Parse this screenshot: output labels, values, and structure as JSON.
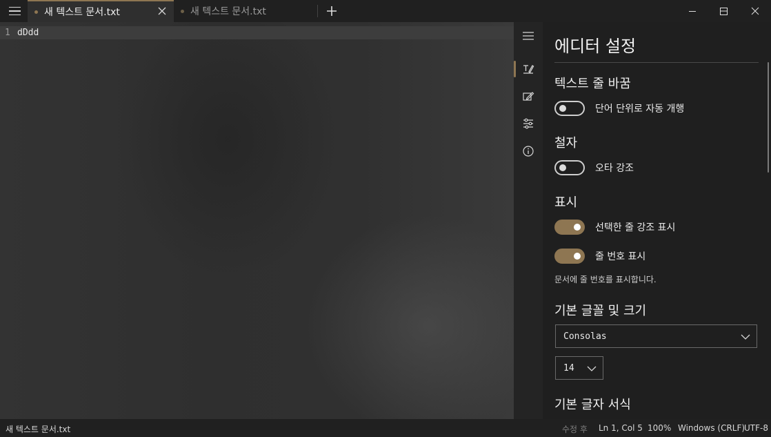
{
  "tabs": [
    {
      "title": "새 텍스트 문서.txt",
      "active": true
    },
    {
      "title": "새 텍스트 문서.txt",
      "active": false
    }
  ],
  "editor": {
    "line_number": "1",
    "content": "dDdd"
  },
  "rail": {
    "icons": [
      "menu-icon",
      "text-edit-icon",
      "note-edit-icon",
      "sliders-icon",
      "info-icon"
    ]
  },
  "settings": {
    "title": "에디터 설정",
    "sections": {
      "text_wrap": {
        "heading": "텍스트 줄 바꿈",
        "toggle_label": "단어 단위로 자동 개행",
        "on": false
      },
      "spelling": {
        "heading": "철자",
        "toggle_label": "오타 강조",
        "on": false
      },
      "display": {
        "heading": "표시",
        "highlight_label": "선택한 줄 강조 표시",
        "highlight_on": true,
        "line_numbers_label": "줄 번호 표시",
        "line_numbers_on": true,
        "description": "문서에 줄 번호를 표시합니다."
      },
      "font": {
        "heading": "기본 글꼴 및 크기",
        "font_family": "Consolas",
        "font_size": "14"
      },
      "format": {
        "heading": "기본 글자 서식"
      }
    }
  },
  "status": {
    "file_name": "새 텍스트 문서.txt",
    "modified": "수정 후",
    "position": "Ln 1, Col 5",
    "zoom": "100%",
    "line_ending": "Windows (CRLF)",
    "encoding": "UTF-8"
  },
  "colors": {
    "accent": "#8e7652",
    "background": "#2b2b2b",
    "panel": "#1f1f1f"
  }
}
